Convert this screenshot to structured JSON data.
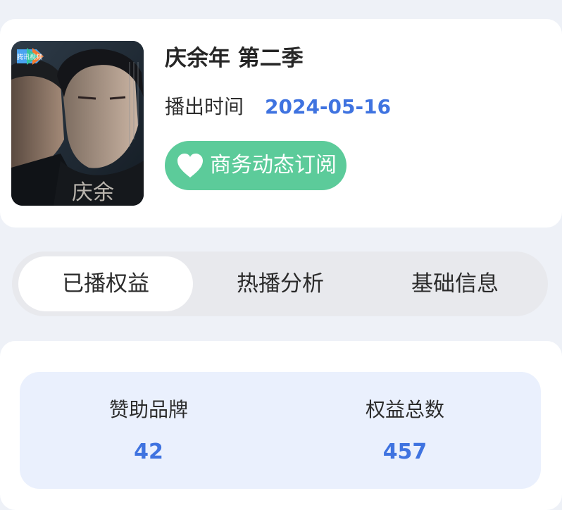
{
  "show": {
    "title": "庆余年 第二季",
    "air_label": "播出时间",
    "air_date": "2024-05-16",
    "poster": {
      "platform_badge": "腾讯视频",
      "calligraphy": "庆余"
    }
  },
  "subscribe": {
    "label": "商务动态订阅",
    "icon": "heart-icon"
  },
  "tabs": [
    {
      "label": "已播权益",
      "active": true
    },
    {
      "label": "热播分析",
      "active": false
    },
    {
      "label": "基础信息",
      "active": false
    }
  ],
  "stats": [
    {
      "label": "赞助品牌",
      "value": "42"
    },
    {
      "label": "权益总数",
      "value": "457"
    }
  ],
  "colors": {
    "accent_blue": "#3f73e0",
    "subscribe_green": "#5ccb9a",
    "page_background": "#eef1f7",
    "stats_background": "#eaf0fd"
  }
}
